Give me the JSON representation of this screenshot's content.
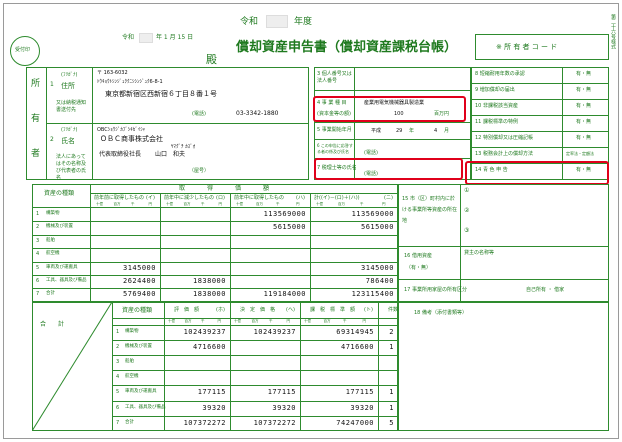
{
  "header": {
    "reiwa": "令和",
    "nendo": "年度",
    "title": "償却資産申告書（償却資産課税台帳）",
    "date_era": "令和",
    "date_rest": "年 1 月 15 日",
    "addressee_suffix": "殿",
    "stamp": "受付印",
    "owner_code_label": "※ 所 有 者 コ ー ド",
    "side_label": "第二十六号様式"
  },
  "owner": {
    "section_label": "所有者",
    "addr_label": "住所",
    "addr_kana_label": "(ﾌﾘｶﾞﾅ)",
    "addr_note": "又は納税通知書送付先",
    "postal": "〒 163-6032",
    "addr_kana": "ﾄｳｷｮｳﾄｼﾝｼﾞｭｸｸﾆｼｼﾝｼﾞｭｸ6-8-1",
    "addr": "東京都新宿区西新宿６丁目８番１号",
    "phone_label": "(電話)",
    "phone": "03-3342-1880",
    "name_label": "氏名",
    "name_kana_label": "(ﾌﾘｶﾞﾅ)",
    "name_note": "法人にあってはその名称及び代表者の氏名",
    "name_kana": "OBCｼｮｳｼﾞｶﾌﾞｼｷｶﾞｲｼｬ",
    "name": "ＯＢＣ商事株式会社",
    "rep_kana": "ﾔﾏｸﾞﾁ ｶｽﾞｵ",
    "rep_title": "代表取締役社長",
    "rep_name": "山口　和夫",
    "phone2_label": "（屋号）",
    "row1": "1",
    "row2": "2"
  },
  "corp": {
    "r3": "3 個人番号又は法人番号",
    "r4": "4 事 業 種 目",
    "r4_sub": "(資本金等の額)",
    "r4_val": "産業用電気機械器具製造業",
    "r4_cap": "100",
    "r4_unit": "百万円",
    "r5": "5 事業開始年月",
    "r5_era": "平成",
    "r5_y": "29",
    "r5_y_unit": "年",
    "r5_m": "4",
    "r5_m_unit": "月",
    "r6": "6 この申告に応答する者の係及び氏名",
    "r6_phone": "(電話)",
    "r7": "7 税理士等の氏名",
    "r7_phone": "(電話)"
  },
  "right": {
    "r8": "8 短縮耐用年数の承認",
    "r9": "9 増加償却の届出",
    "r10": "10 非課税該当資産",
    "r11": "11 課税標準の特例",
    "r12": "12 特別償却又は圧縮記帳",
    "r13": "13 税務会計上の償却方法",
    "r13_val": "定率法・定額法",
    "r14": "14 青 色 申 告",
    "yn": "有・無"
  },
  "mid": {
    "r15": "15 市（区）町村内に於ける事業所等資産の所在地",
    "circ1": "①",
    "circ2": "②",
    "circ3": "③",
    "r16": "16 借用資産",
    "r16_val": "（有・無）",
    "r16_owner": "貸主の名称等",
    "r17": "17 事業所用家屋の所有区分",
    "r17_val": "自己所有 ・ 借家",
    "r18": "18 備考（添付書類等）"
  },
  "upper_table": {
    "header_group": "取　得　価　額",
    "col_type": "資産の種類",
    "col_a": "前年前に取得したもの",
    "col_a_sub": "(イ)",
    "col_b": "前年中に減少したもの",
    "col_b_sub": "(ロ)",
    "col_c": "前年中に取得したもの",
    "col_c_sub": "(ハ)",
    "col_d": "計((イ)－(ロ)＋(ハ))",
    "col_d_sub": "(ニ)",
    "units": [
      "十億",
      "百万",
      "千",
      "円"
    ],
    "rows": [
      {
        "no": "1",
        "name": "構築物",
        "a": "",
        "b": "",
        "c": "113569000",
        "d": "113569000"
      },
      {
        "no": "2",
        "name": "機械及び装置",
        "a": "",
        "b": "",
        "c": "5615000",
        "d": "5615000"
      },
      {
        "no": "3",
        "name": "船舶",
        "a": "",
        "b": "",
        "c": "",
        "d": ""
      },
      {
        "no": "4",
        "name": "航空機",
        "a": "",
        "b": "",
        "c": "",
        "d": ""
      },
      {
        "no": "5",
        "name": "車両及び運搬具",
        "a": "3145000",
        "b": "",
        "c": "",
        "d": "3145000"
      },
      {
        "no": "6",
        "name": "工具、器具及び備品",
        "a": "2624400",
        "b": "1838000",
        "c": "",
        "d": "786400"
      },
      {
        "no": "7",
        "name": "合計",
        "a": "5769400",
        "b": "1838000",
        "c": "119184000",
        "d": "123115400"
      }
    ]
  },
  "lower_table": {
    "col_type": "資産の種類",
    "col_a": "評　価　額",
    "col_a_sub": "(ホ)",
    "col_b": "決　定　価　格",
    "col_b_sub": "(ヘ)",
    "col_c": "課　税　標　準　額",
    "col_c_sub": "(ト)",
    "col_d": "件数",
    "total_label": "合　　計",
    "units": [
      "十億",
      "百万",
      "千",
      "円"
    ],
    "rows": [
      {
        "no": "1",
        "name": "構築物",
        "a": "102439237",
        "b": "102439237",
        "c": "69314945",
        "d": "2"
      },
      {
        "no": "2",
        "name": "機械及び装置",
        "a": "4716600",
        "b": "",
        "c": "4716600",
        "d": "1"
      },
      {
        "no": "3",
        "name": "船舶",
        "a": "",
        "b": "",
        "c": "",
        "d": ""
      },
      {
        "no": "4",
        "name": "航空機",
        "a": "",
        "b": "",
        "c": "",
        "d": ""
      },
      {
        "no": "5",
        "name": "車両及び運搬具",
        "a": "177115",
        "b": "177115",
        "c": "177115",
        "d": "1"
      },
      {
        "no": "6",
        "name": "工具、器具及び備品",
        "a": "39320",
        "b": "39320",
        "c": "39320",
        "d": "1"
      },
      {
        "no": "7",
        "name": "合計",
        "a": "107372272",
        "b": "107372272",
        "c": "74247000",
        "d": "5"
      }
    ]
  },
  "highlight_color": "#e0001b",
  "form_color": "#2e8b2e"
}
